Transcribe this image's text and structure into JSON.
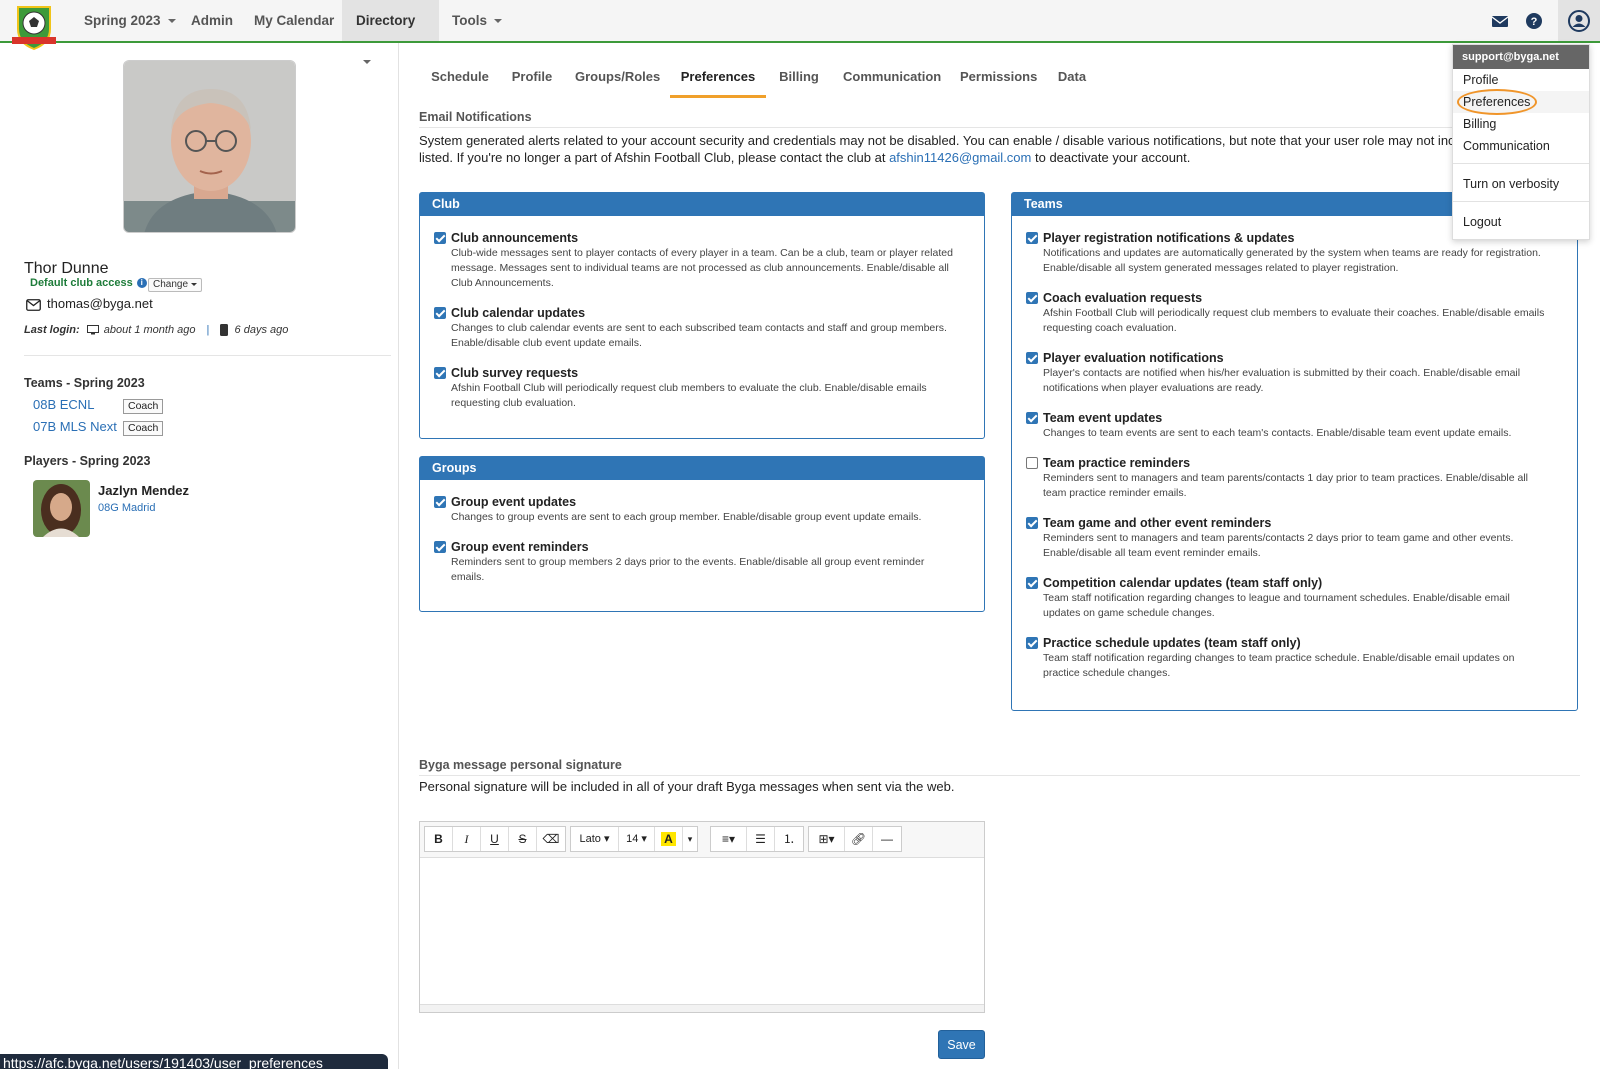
{
  "nav": {
    "season": "Spring 2023",
    "admin": "Admin",
    "my_calendar": "My Calendar",
    "directory": "Directory",
    "tools": "Tools"
  },
  "profile": {
    "name": "Thor Dunne",
    "club_access": "Default club access",
    "change_label": "Change",
    "email": "thomas@byga.net",
    "last_login_label": "Last login:",
    "last_login_desktop": "about 1 month ago",
    "last_login_mobile": "6 days ago",
    "teams_heading": "Teams - Spring 2023",
    "teams": [
      {
        "name": "08B ECNL",
        "role": "Coach"
      },
      {
        "name": "07B MLS Next",
        "role": "Coach"
      }
    ],
    "players_heading": "Players - Spring 2023",
    "players": [
      {
        "name": "Jazlyn Mendez",
        "team": "08G Madrid"
      }
    ]
  },
  "tabs": [
    "Schedule",
    "Profile",
    "Groups/Roles",
    "Preferences",
    "Billing",
    "Communication",
    "Permissions",
    "Data"
  ],
  "email_notifications": {
    "heading": "Email Notifications",
    "text_1": "System generated alerts related to your account security and credentials may not be disabled. You can enable / disable various notifications, but note that your user role may not include a",
    "text_2a": "listed. If you're no longer a part of Afshin Football Club, please contact the club at",
    "contact_email": "afshin11426@gmail.com",
    "text_2b": "to deactivate your account."
  },
  "club_panel": {
    "title": "Club",
    "options": [
      {
        "title": "Club announcements",
        "desc_1": "Club-wide messages sent to player contacts of every player in a team. Can be a club, team or player related",
        "desc_2": "message. Messages sent to individual teams are not processed as club announcements. Enable/disable all",
        "desc_3": "Club Announcements.",
        "checked": true
      },
      {
        "title": "Club calendar updates",
        "desc_1": "Changes to club calendar events are sent to each subscribed team contacts and staff and group members.",
        "desc_2": "Enable/disable club event update emails.",
        "checked": true
      },
      {
        "title": "Club survey requests",
        "desc_1": "Afshin Football Club will periodically request club members to evaluate the club. Enable/disable emails",
        "desc_2": "requesting club evaluation.",
        "checked": true
      }
    ]
  },
  "groups_panel": {
    "title": "Groups",
    "options": [
      {
        "title": "Group event updates",
        "desc_1": "Changes to group events are sent to each group member. Enable/disable group event update emails.",
        "checked": true
      },
      {
        "title": "Group event reminders",
        "desc_1": "Reminders sent to group members 2 days prior to the events. Enable/disable all group event reminder",
        "desc_2": "emails.",
        "checked": true
      }
    ]
  },
  "teams_panel": {
    "title": "Teams",
    "options": [
      {
        "title": "Player registration notifications & updates",
        "desc_1": "Notifications and updates are automatically generated by the system when teams are ready for registration.",
        "desc_2": "Enable/disable all system generated messages related to player registration.",
        "checked": true
      },
      {
        "title": "Coach evaluation requests",
        "desc_1": "Afshin Football Club will periodically request club members to evaluate their coaches. Enable/disable emails",
        "desc_2": "requesting coach evaluation.",
        "checked": true
      },
      {
        "title": "Player evaluation notifications",
        "desc_1": "Player's contacts are notified when his/her evaluation is submitted by their coach. Enable/disable email",
        "desc_2": "notifications when player evaluations are ready.",
        "checked": true
      },
      {
        "title": "Team event updates",
        "desc_1": "Changes to team events are sent to each team's contacts. Enable/disable team event update emails.",
        "checked": true
      },
      {
        "title": "Team practice reminders",
        "desc_1": "Reminders sent to managers and team parents/contacts 1 day prior to team practices. Enable/disable all",
        "desc_2": "team practice reminder emails.",
        "checked": false
      },
      {
        "title": "Team game and other event reminders",
        "desc_1": "Reminders sent to managers and team parents/contacts 2 days prior to team game and other events.",
        "desc_2": "Enable/disable all team event reminder emails.",
        "checked": true
      },
      {
        "title": "Competition calendar updates (team staff only)",
        "desc_1": "Team staff notification regarding changes to league and tournament schedules. Enable/disable email",
        "desc_2": "updates on game schedule changes.",
        "checked": true
      },
      {
        "title": "Practice schedule updates (team staff only)",
        "desc_1": "Team staff notification regarding changes to team practice schedule. Enable/disable email updates on",
        "desc_2": "practice schedule changes.",
        "checked": true
      }
    ]
  },
  "signature": {
    "heading": "Byga message personal signature",
    "text": "Personal signature will be included in all of your draft Byga messages when sent via the web.",
    "font_name": "Lato",
    "font_size": "14"
  },
  "save_label": "Save",
  "dropdown": {
    "header": "support@byga.net",
    "items": [
      "Profile",
      "Preferences",
      "Billing",
      "Communication",
      "Turn on verbosity",
      "Logout"
    ]
  },
  "status_url": "https://afc.byga.net/users/191403/user_preferences",
  "colors": {
    "accent": "#2f75b5",
    "active_tab": "#f0a02a",
    "nav_border": "#3d9a3a",
    "highlight": "#f0952a"
  }
}
